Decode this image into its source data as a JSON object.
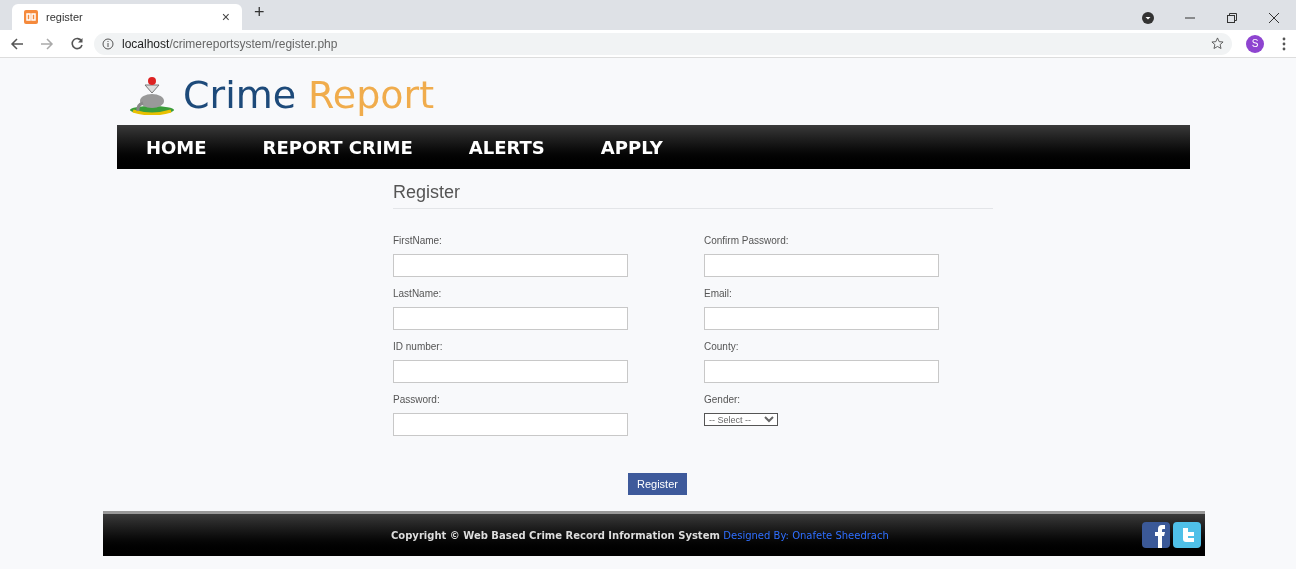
{
  "browser": {
    "tab_title": "register",
    "new_tab": "+",
    "close_tab": "×",
    "url_host": "localhost",
    "url_path": "/crimereportsystem/register.php",
    "avatar": "S"
  },
  "logo": {
    "word1": "Crime",
    "word2": "Report"
  },
  "nav": [
    "HOME",
    "REPORT CRIME",
    "ALERTS",
    "APPLY"
  ],
  "form": {
    "title": "Register",
    "columns": [
      [
        {
          "label": "FirstName:",
          "kind": "text"
        },
        {
          "label": "LastName:",
          "kind": "text"
        },
        {
          "label": "ID number:",
          "kind": "text"
        },
        {
          "label": "Password:",
          "kind": "text"
        }
      ],
      [
        {
          "label": "Confirm Password:",
          "kind": "text"
        },
        {
          "label": "Email:",
          "kind": "text"
        },
        {
          "label": "County:",
          "kind": "text"
        },
        {
          "label": "Gender:",
          "kind": "select",
          "value": "-- Select --"
        }
      ]
    ],
    "submit": "Register"
  },
  "footer": {
    "text": "Copyright © Web Based Crime Record Information System",
    "link": "Designed By: Onafete Sheedrach"
  }
}
